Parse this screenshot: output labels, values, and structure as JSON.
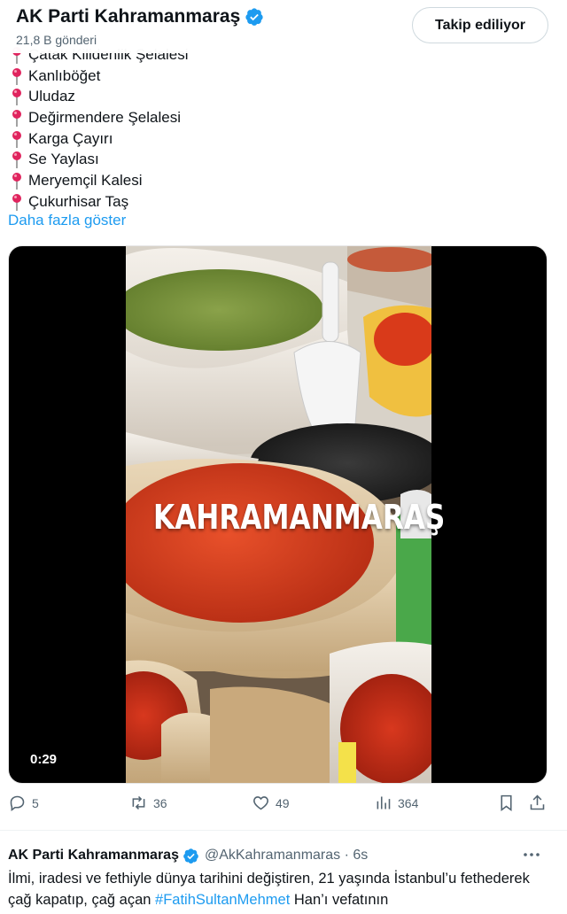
{
  "header": {
    "account_name": "AK Parti Kahramanmaraş",
    "post_count": "21,8 B gönderi",
    "follow_button": "Takip ediliyor"
  },
  "places": [
    "Çatak Kilidenlik Şelalesi",
    "Kanlıböğet",
    "Uludaz",
    "Değirmendere Şelalesi",
    "Karga Çayırı",
    "Se Yaylası",
    "Meryemçil Kalesi",
    "Çukurhisar Taş"
  ],
  "show_more": "Daha fazla göster",
  "video": {
    "overlay_title": "KAHRAMANMARAŞ",
    "duration": "0:29"
  },
  "actions": {
    "replies": "5",
    "reposts": "36",
    "likes": "49",
    "views": "364"
  },
  "next_tweet": {
    "name": "AK Parti Kahramanmaraş",
    "handle": "@AkKahramanmaras · 6s",
    "text_part1": "İlmi, iradesi ve fethiyle dünya tarihini değiştiren, 21 yaşında İstanbul’u fethederek çağ kapatıp, çağ açan ",
    "hashtag": "#FatihSultanMehmet",
    "text_part2": " Han’ı vefatının"
  },
  "colors": {
    "accent": "#1d9bf0",
    "secondary_text": "#536471",
    "verified": "#1d9bf0",
    "pin": "#e0245e"
  }
}
